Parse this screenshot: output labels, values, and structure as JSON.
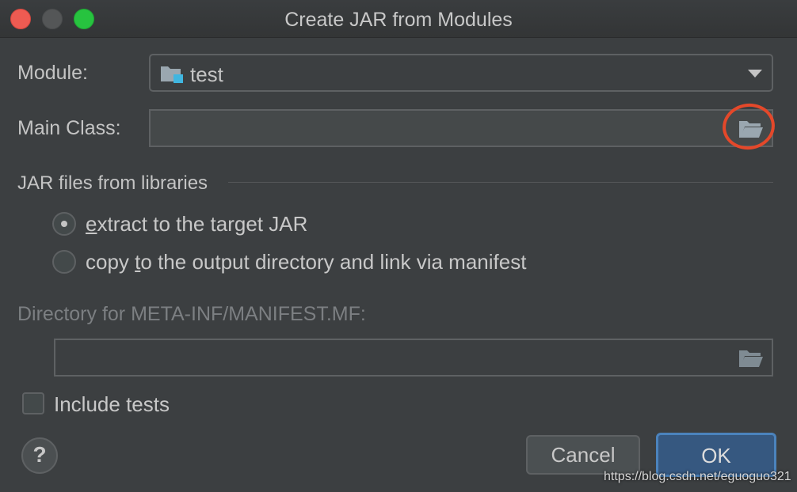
{
  "window": {
    "title": "Create JAR from Modules"
  },
  "module": {
    "label": "Module:",
    "value": "test",
    "icon": "module-folder-icon"
  },
  "main_class": {
    "label": "Main Class:",
    "value": "",
    "browse_icon": "folder-open-icon"
  },
  "libraries": {
    "section_title": "JAR files from libraries",
    "options": [
      {
        "pre": "",
        "mnemonic": "e",
        "post": "xtract to the target JAR",
        "checked": true
      },
      {
        "pre": "copy ",
        "mnemonic": "t",
        "post": "o the output directory and link via manifest",
        "checked": false
      }
    ]
  },
  "manifest": {
    "label": "Directory for META-INF/MANIFEST.MF:",
    "value": "",
    "browse_icon": "folder-open-icon"
  },
  "include_tests": {
    "label": "Include tests",
    "checked": false
  },
  "footer": {
    "help_label": "?",
    "cancel_label": "Cancel",
    "ok_label": "OK"
  },
  "watermark": "https://blog.csdn.net/eguoguo321",
  "colors": {
    "background": "#3c3f41",
    "accent": "#365880",
    "annotation": "#e4482a"
  }
}
